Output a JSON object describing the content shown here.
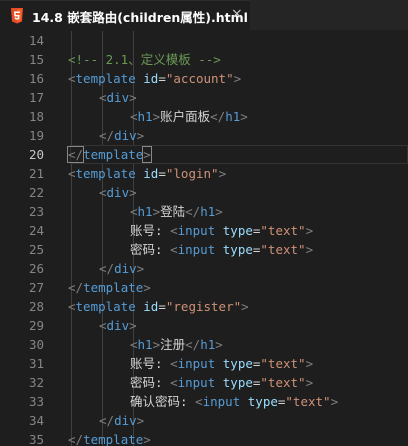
{
  "tab": {
    "title": "14.8 嵌套路由(children属性).html",
    "icon": "html5-icon",
    "close_symbol": "×"
  },
  "editor": {
    "active_line": 20,
    "lines": [
      {
        "n": "14",
        "indent": 0,
        "tokens": []
      },
      {
        "n": "15",
        "indent": 1,
        "tokens": [
          [
            "cmt",
            "<!-- 2.1、定义模板 -->"
          ]
        ]
      },
      {
        "n": "16",
        "indent": 1,
        "tokens": [
          [
            "punct",
            "<"
          ],
          [
            "tag",
            "template"
          ],
          [
            "text",
            " "
          ],
          [
            "attr",
            "id"
          ],
          [
            "text",
            "="
          ],
          [
            "str",
            "\"account\""
          ],
          [
            "punct",
            ">"
          ]
        ]
      },
      {
        "n": "17",
        "indent": 2,
        "tokens": [
          [
            "punct",
            "<"
          ],
          [
            "tag",
            "div"
          ],
          [
            "punct",
            ">"
          ]
        ]
      },
      {
        "n": "18",
        "indent": 3,
        "tokens": [
          [
            "punct",
            "<"
          ],
          [
            "tag",
            "h1"
          ],
          [
            "punct",
            ">"
          ],
          [
            "text",
            "账户面板"
          ],
          [
            "punct",
            "</"
          ],
          [
            "tag",
            "h1"
          ],
          [
            "punct",
            ">"
          ]
        ]
      },
      {
        "n": "19",
        "indent": 2,
        "tokens": [
          [
            "punct",
            "</"
          ],
          [
            "tag",
            "div"
          ],
          [
            "punct",
            ">"
          ]
        ]
      },
      {
        "n": "20",
        "indent": 1,
        "tokens": [
          [
            "punct",
            "</"
          ],
          [
            "tag",
            "template"
          ],
          [
            "punct",
            ">"
          ]
        ]
      },
      {
        "n": "21",
        "indent": 1,
        "tokens": [
          [
            "punct",
            "<"
          ],
          [
            "tag",
            "template"
          ],
          [
            "text",
            " "
          ],
          [
            "attr",
            "id"
          ],
          [
            "text",
            "="
          ],
          [
            "str",
            "\"login\""
          ],
          [
            "punct",
            ">"
          ]
        ]
      },
      {
        "n": "22",
        "indent": 2,
        "tokens": [
          [
            "punct",
            "<"
          ],
          [
            "tag",
            "div"
          ],
          [
            "punct",
            ">"
          ]
        ]
      },
      {
        "n": "23",
        "indent": 3,
        "tokens": [
          [
            "punct",
            "<"
          ],
          [
            "tag",
            "h1"
          ],
          [
            "punct",
            ">"
          ],
          [
            "text",
            "登陆"
          ],
          [
            "punct",
            "</"
          ],
          [
            "tag",
            "h1"
          ],
          [
            "punct",
            ">"
          ]
        ]
      },
      {
        "n": "24",
        "indent": 3,
        "tokens": [
          [
            "text",
            "账号: "
          ],
          [
            "punct",
            "<"
          ],
          [
            "tag",
            "input"
          ],
          [
            "text",
            " "
          ],
          [
            "attr",
            "type"
          ],
          [
            "text",
            "="
          ],
          [
            "str",
            "\"text\""
          ],
          [
            "punct",
            ">"
          ]
        ]
      },
      {
        "n": "25",
        "indent": 3,
        "tokens": [
          [
            "text",
            "密码: "
          ],
          [
            "punct",
            "<"
          ],
          [
            "tag",
            "input"
          ],
          [
            "text",
            " "
          ],
          [
            "attr",
            "type"
          ],
          [
            "text",
            "="
          ],
          [
            "str",
            "\"text\""
          ],
          [
            "punct",
            ">"
          ]
        ]
      },
      {
        "n": "26",
        "indent": 2,
        "tokens": [
          [
            "punct",
            "</"
          ],
          [
            "tag",
            "div"
          ],
          [
            "punct",
            ">"
          ]
        ]
      },
      {
        "n": "27",
        "indent": 1,
        "tokens": [
          [
            "punct",
            "</"
          ],
          [
            "tag",
            "template"
          ],
          [
            "punct",
            ">"
          ]
        ]
      },
      {
        "n": "28",
        "indent": 1,
        "tokens": [
          [
            "punct",
            "<"
          ],
          [
            "tag",
            "template"
          ],
          [
            "text",
            " "
          ],
          [
            "attr",
            "id"
          ],
          [
            "text",
            "="
          ],
          [
            "str",
            "\"register\""
          ],
          [
            "punct",
            ">"
          ]
        ]
      },
      {
        "n": "29",
        "indent": 2,
        "tokens": [
          [
            "punct",
            "<"
          ],
          [
            "tag",
            "div"
          ],
          [
            "punct",
            ">"
          ]
        ]
      },
      {
        "n": "30",
        "indent": 3,
        "tokens": [
          [
            "punct",
            "<"
          ],
          [
            "tag",
            "h1"
          ],
          [
            "punct",
            ">"
          ],
          [
            "text",
            "注册"
          ],
          [
            "punct",
            "</"
          ],
          [
            "tag",
            "h1"
          ],
          [
            "punct",
            ">"
          ]
        ]
      },
      {
        "n": "31",
        "indent": 3,
        "tokens": [
          [
            "text",
            "账号: "
          ],
          [
            "punct",
            "<"
          ],
          [
            "tag",
            "input"
          ],
          [
            "text",
            " "
          ],
          [
            "attr",
            "type"
          ],
          [
            "text",
            "="
          ],
          [
            "str",
            "\"text\""
          ],
          [
            "punct",
            ">"
          ]
        ]
      },
      {
        "n": "32",
        "indent": 3,
        "tokens": [
          [
            "text",
            "密码: "
          ],
          [
            "punct",
            "<"
          ],
          [
            "tag",
            "input"
          ],
          [
            "text",
            " "
          ],
          [
            "attr",
            "type"
          ],
          [
            "text",
            "="
          ],
          [
            "str",
            "\"text\""
          ],
          [
            "punct",
            ">"
          ]
        ]
      },
      {
        "n": "33",
        "indent": 3,
        "tokens": [
          [
            "text",
            "确认密码: "
          ],
          [
            "punct",
            "<"
          ],
          [
            "tag",
            "input"
          ],
          [
            "text",
            " "
          ],
          [
            "attr",
            "type"
          ],
          [
            "text",
            "="
          ],
          [
            "str",
            "\"text\""
          ],
          [
            "punct",
            ">"
          ]
        ]
      },
      {
        "n": "34",
        "indent": 2,
        "tokens": [
          [
            "punct",
            "</"
          ],
          [
            "tag",
            "div"
          ],
          [
            "punct",
            ">"
          ]
        ]
      },
      {
        "n": "35",
        "indent": 1,
        "tokens": [
          [
            "punct",
            "</"
          ],
          [
            "tag",
            "template"
          ],
          [
            "punct",
            ">"
          ]
        ]
      }
    ]
  },
  "colors": {
    "background": "#1e1e1e",
    "tag": "#569cd6",
    "attribute": "#9cdcfe",
    "string": "#ce9178",
    "comment": "#6a9955",
    "punctuation": "#808080",
    "text": "#d4d4d4",
    "line_number": "#858585"
  }
}
